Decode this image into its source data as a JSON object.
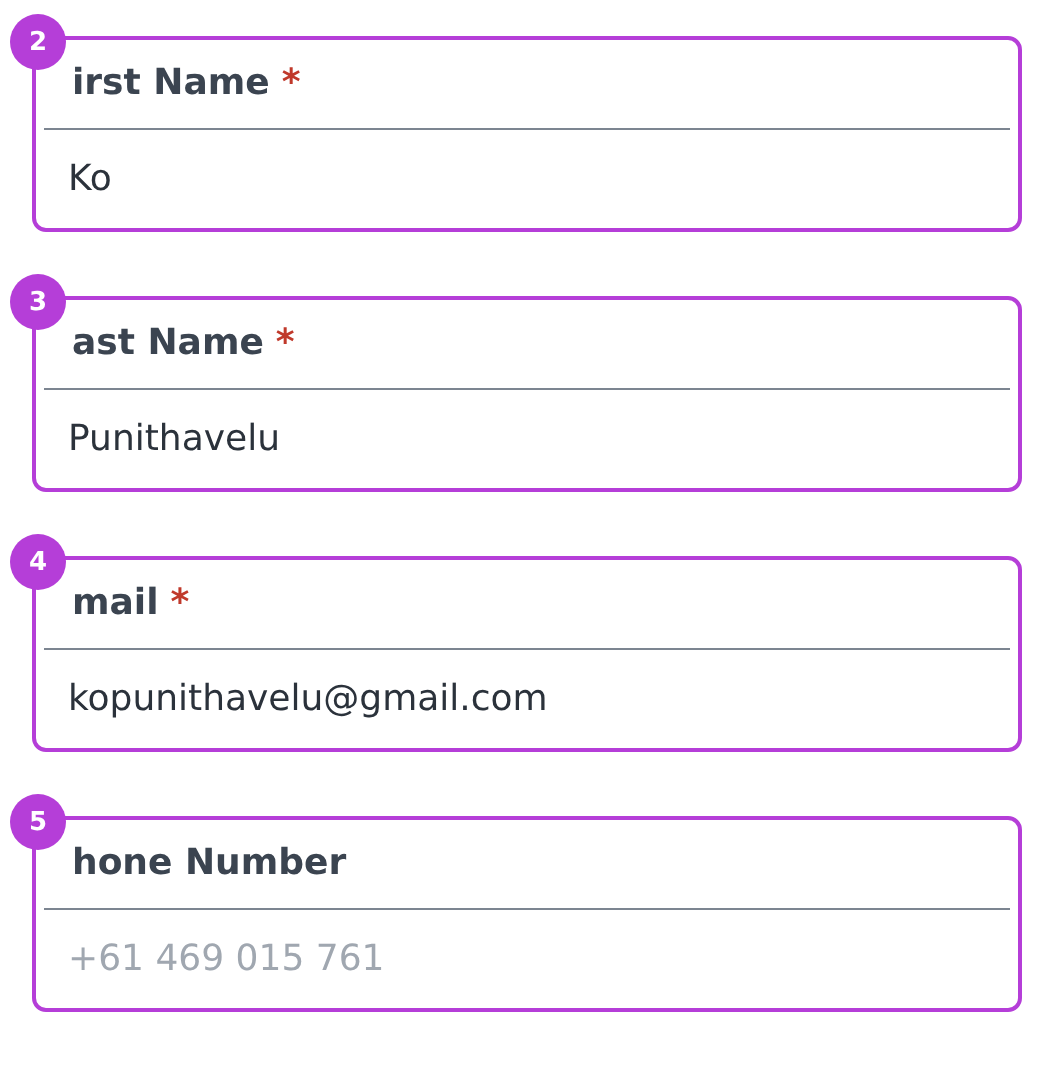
{
  "fields": [
    {
      "badge": "2",
      "label": "irst Name",
      "required_mark": "*",
      "value": "Ko"
    },
    {
      "badge": "3",
      "label": "ast Name",
      "required_mark": "*",
      "value": "Punithavelu"
    },
    {
      "badge": "4",
      "label": "mail",
      "required_mark": "*",
      "value": "kopunithavelu@gmail.com"
    },
    {
      "badge": "5",
      "label": "hone Number",
      "placeholder": "+61 469 015 761"
    }
  ]
}
